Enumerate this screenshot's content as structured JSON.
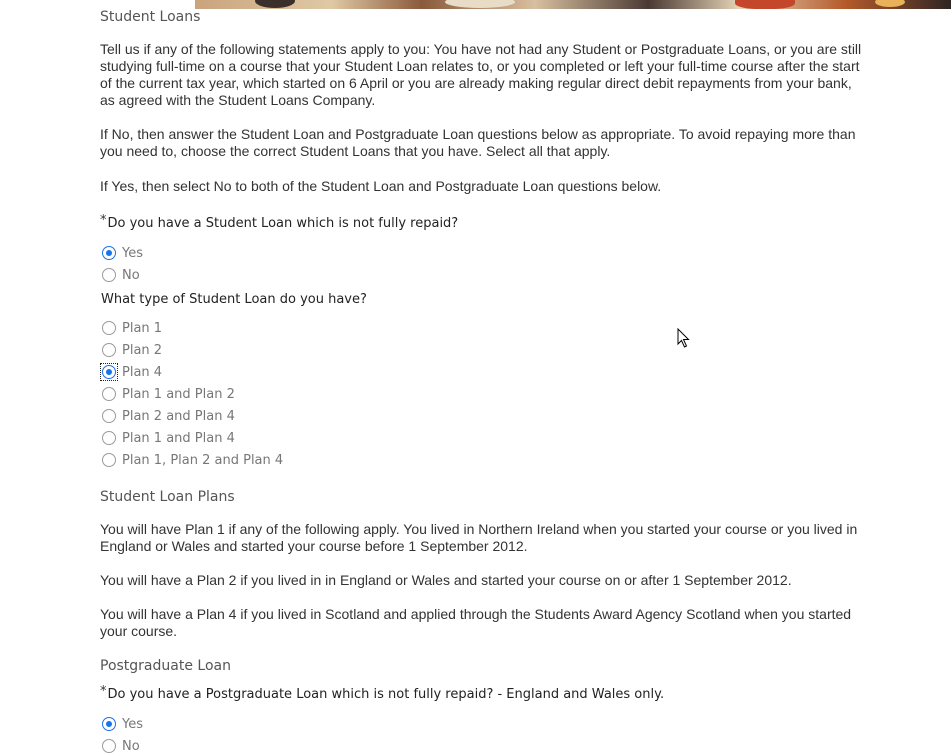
{
  "student_loans": {
    "heading": "Student Loans",
    "intro_paragraphs": [
      "Tell us if any of the following statements apply to you: You have not had any Student or Postgraduate Loans, or you are still studying full-time on a course that your Student Loan relates to, or you completed or left your full-time course after the start of the current tax year, which started on 6 April or you are already making regular direct debit repayments from your bank, as agreed with the Student Loans Company.",
      "If No, then answer the Student Loan and Postgraduate Loan questions below as appropriate. To avoid repaying more than you need to, choose the correct Student Loans that you have. Select all that apply.",
      "If Yes, then select No to both of the Student Loan and Postgraduate Loan questions below."
    ],
    "question": {
      "required_mark": "*",
      "label": "Do you have a Student Loan which is not fully repaid?",
      "options": [
        {
          "label": "Yes",
          "checked": true
        },
        {
          "label": "No",
          "checked": false
        }
      ]
    },
    "type_question": {
      "label": "What type of Student Loan do you have?",
      "options": [
        {
          "label": "Plan 1",
          "checked": false
        },
        {
          "label": "Plan 2",
          "checked": false
        },
        {
          "label": "Plan 4",
          "checked": true,
          "focused": true
        },
        {
          "label": "Plan 1 and Plan 2",
          "checked": false
        },
        {
          "label": "Plan 2 and Plan 4",
          "checked": false
        },
        {
          "label": "Plan 1 and Plan 4",
          "checked": false
        },
        {
          "label": "Plan 1, Plan 2 and Plan 4",
          "checked": false
        }
      ]
    }
  },
  "plans": {
    "heading": "Student Loan Plans",
    "paragraphs": [
      "You will have Plan 1 if any of the following apply. You lived in Northern Ireland when you started your course or you lived in England or Wales and started your course before 1 September 2012.",
      "You will have a Plan 2 if you lived in in England or Wales and started your course on or after 1 September 2012.",
      "You will have a Plan 4 if you lived in Scotland and applied through the Students Award Agency Scotland when you started your course."
    ]
  },
  "postgraduate": {
    "heading": "Postgraduate Loan",
    "question": {
      "required_mark": "*",
      "label": "Do you have a Postgraduate Loan which is not fully repaid? - England and Wales only.",
      "options": [
        {
          "label": "Yes",
          "checked": true
        },
        {
          "label": "No",
          "checked": false
        }
      ]
    }
  },
  "colors": {
    "radio_selected": "#1a73e8",
    "text": "#333333",
    "option_text": "#777777"
  }
}
